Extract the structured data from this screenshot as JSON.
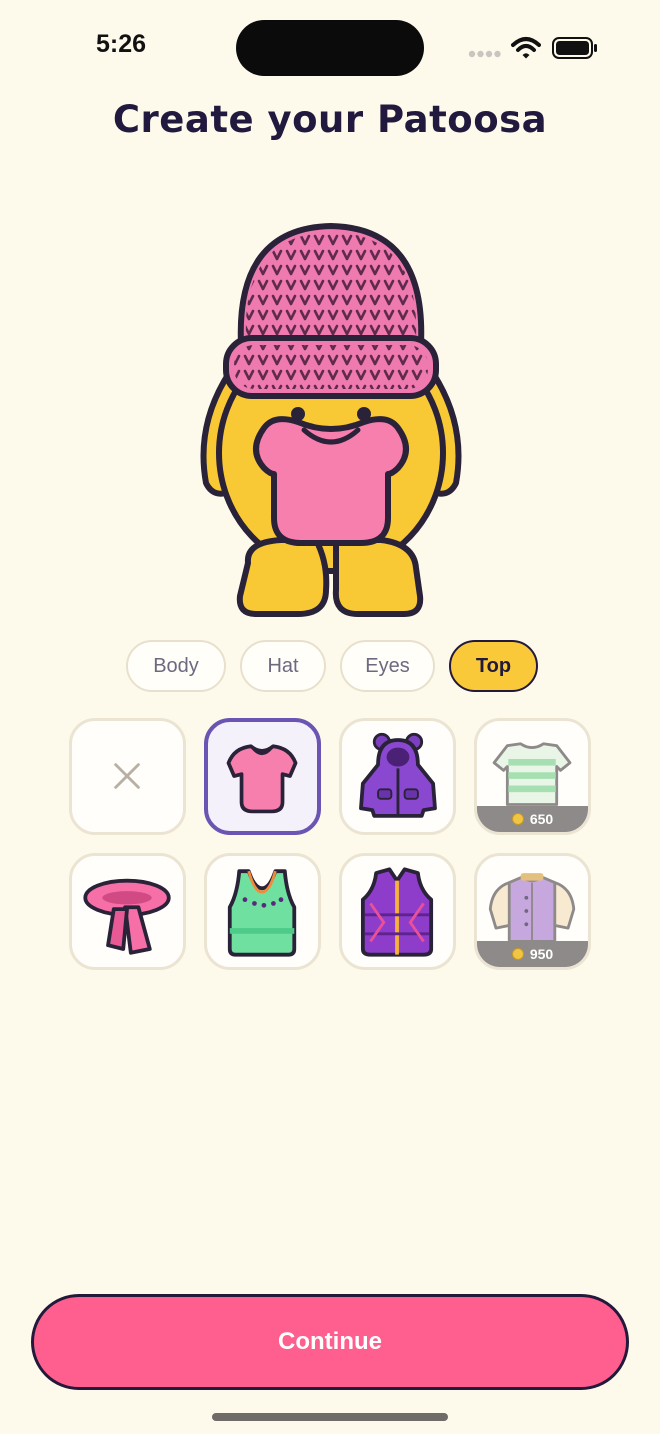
{
  "status_bar": {
    "time": "5:26",
    "icons": [
      "signal-icon",
      "wifi-icon",
      "battery-icon"
    ]
  },
  "title": "Create your Patoosa",
  "tabs": [
    {
      "label": "Body",
      "active": false
    },
    {
      "label": "Hat",
      "active": false
    },
    {
      "label": "Eyes",
      "active": false
    },
    {
      "label": "Top",
      "active": true
    }
  ],
  "items": [
    {
      "icon": "none-x-icon",
      "selected": false
    },
    {
      "icon": "pink-tshirt-icon",
      "selected": true
    },
    {
      "icon": "purple-bear-hoodie-icon",
      "selected": false
    },
    {
      "icon": "striped-green-sweater-icon",
      "selected": false,
      "price": "650"
    },
    {
      "icon": "pink-scarf-icon",
      "selected": false
    },
    {
      "icon": "green-tank-top-icon",
      "selected": false
    },
    {
      "icon": "purple-puffer-vest-icon",
      "selected": false
    },
    {
      "icon": "varsity-jacket-icon",
      "selected": false,
      "price": "950"
    }
  ],
  "continue_label": "Continue",
  "colors": {
    "background": "#fdfaec",
    "accent_pink": "#ff5f8f",
    "active_tab": "#f9c93a",
    "selected_border": "#6a55b3",
    "text_dark": "#22193b"
  }
}
